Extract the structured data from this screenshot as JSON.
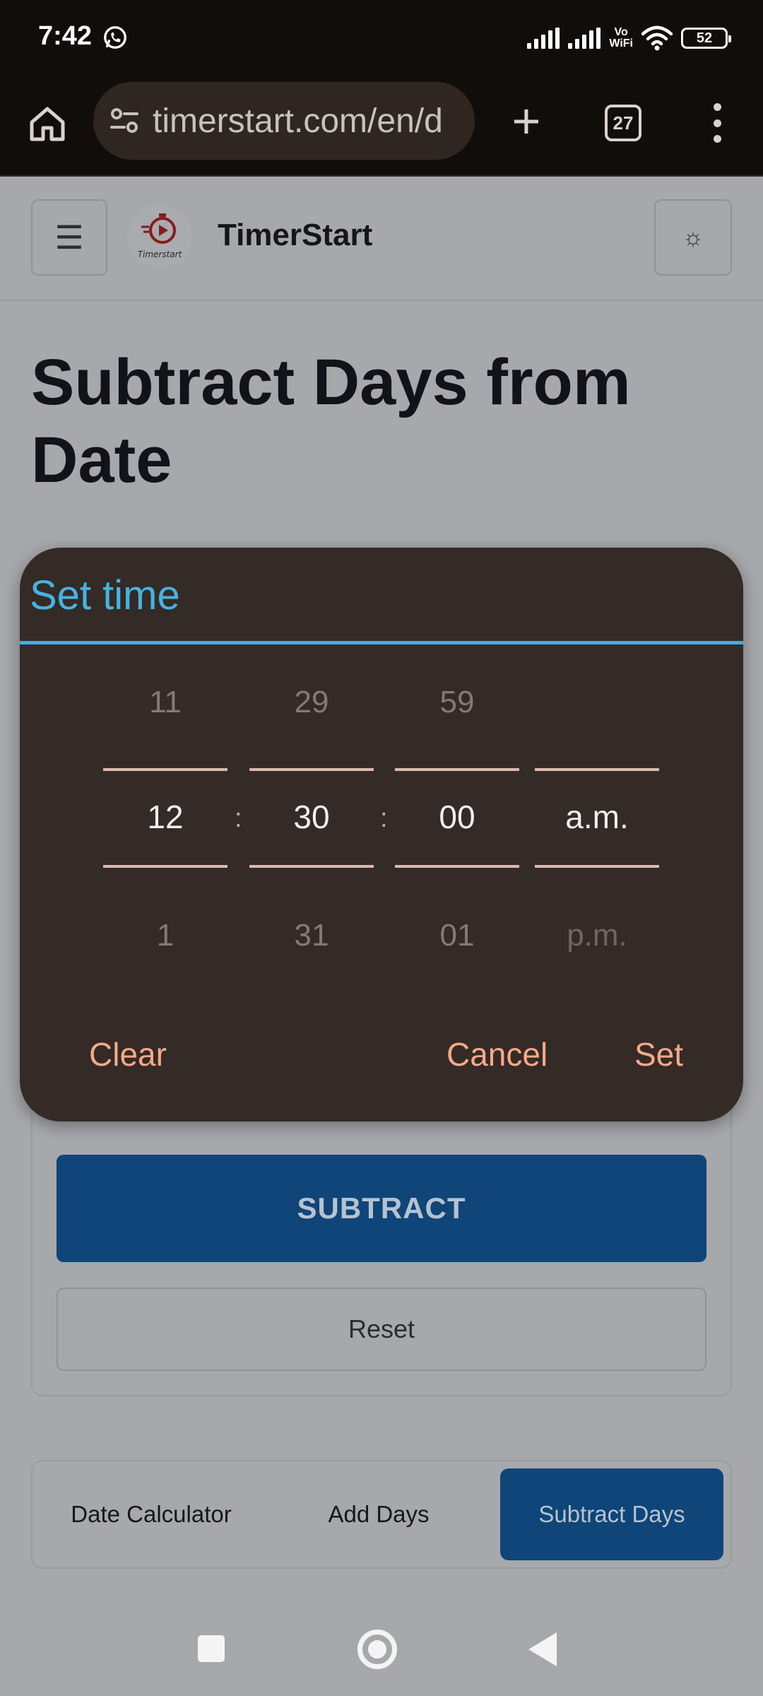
{
  "status_bar": {
    "time": "7:42",
    "vo_top": "Vo",
    "vo_bottom": "WiFi",
    "battery": "52"
  },
  "browser": {
    "url": "timerstart.com/en/d",
    "tab_count": "27"
  },
  "site": {
    "name": "TimerStart",
    "logo_text": "Timerstart",
    "menu_icon": "☰",
    "theme_icon": "☼",
    "page_title": "Subtract Days from Date"
  },
  "form": {
    "subtract_label": "SUBTRACT",
    "reset_label": "Reset"
  },
  "nav_tabs": [
    {
      "label": "Date Calculator",
      "active": false
    },
    {
      "label": "Add Days",
      "active": false
    },
    {
      "label": "Subtract Days",
      "active": true
    }
  ],
  "dialog": {
    "title": "Set time",
    "separator": ":",
    "hours": {
      "prev": "11",
      "current": "12",
      "next": "1"
    },
    "minutes": {
      "prev": "29",
      "current": "30",
      "next": "31"
    },
    "seconds": {
      "prev": "59",
      "current": "00",
      "next": "01"
    },
    "period": {
      "prev": "",
      "current": "a.m.",
      "next": "p.m."
    },
    "clear_label": "Clear",
    "cancel_label": "Cancel",
    "set_label": "Set"
  },
  "colors": {
    "accent": "#44b4e2",
    "dialog_bg": "#342a26",
    "action_text": "#f6a98a",
    "primary_button": "#0f4578"
  }
}
